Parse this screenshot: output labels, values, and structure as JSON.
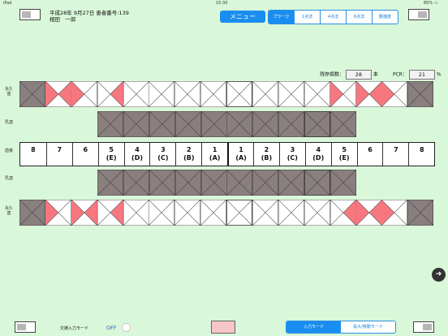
{
  "status_bar": {
    "device": "iPad",
    "time": "15:30",
    "battery": "85% ▭"
  },
  "patient": {
    "line1": "平成28年 9月27日 患者番号:139",
    "line2": "相田　一郎"
  },
  "menu": {
    "label": "メニュー"
  },
  "tabs": [
    {
      "label": "プラーク",
      "active": true
    },
    {
      "label": "1点法",
      "active": false
    },
    {
      "label": "4点法",
      "active": false
    },
    {
      "label": "6点法",
      "active": false
    },
    {
      "label": "動揺度",
      "active": false
    }
  ],
  "counters": {
    "remaining_label": "残存歯数：",
    "remaining_value": "28",
    "remaining_unit": "本",
    "pcr_label": "PCR：",
    "pcr_value": "21",
    "pcr_unit": "%"
  },
  "side_labels": {
    "permanent_upper": "永久歯",
    "deciduous_upper": "乳歯",
    "tooth_number": "歯番",
    "deciduous_lower": "乳歯",
    "permanent_lower": "永久歯"
  },
  "tooth_numbers": [
    {
      "n": "8",
      "sub": ""
    },
    {
      "n": "7",
      "sub": ""
    },
    {
      "n": "6",
      "sub": ""
    },
    {
      "n": "5",
      "sub": "(E)"
    },
    {
      "n": "4",
      "sub": "(D)"
    },
    {
      "n": "3",
      "sub": "(C)"
    },
    {
      "n": "2",
      "sub": "(B)"
    },
    {
      "n": "1",
      "sub": "(A)"
    },
    {
      "n": "1",
      "sub": "(A)"
    },
    {
      "n": "2",
      "sub": "(B)"
    },
    {
      "n": "3",
      "sub": "(C)"
    },
    {
      "n": "4",
      "sub": "(D)"
    },
    {
      "n": "5",
      "sub": "(E)"
    },
    {
      "n": "6",
      "sub": ""
    },
    {
      "n": "7",
      "sub": ""
    },
    {
      "n": "8",
      "sub": ""
    }
  ],
  "upper_permanent": [
    {
      "state": "missing"
    },
    {
      "state": "plaque",
      "m": true,
      "d": true,
      "t": false,
      "b": false
    },
    {
      "state": "plaque",
      "m": true,
      "d": false,
      "t": false,
      "b": false
    },
    {
      "state": "plaque",
      "m": false,
      "d": true,
      "t": false,
      "b": false
    },
    {
      "state": "clear"
    },
    {
      "state": "clear"
    },
    {
      "state": "clear"
    },
    {
      "state": "clear"
    },
    {
      "state": "clear"
    },
    {
      "state": "clear"
    },
    {
      "state": "clear"
    },
    {
      "state": "clear"
    },
    {
      "state": "plaque",
      "m": true,
      "d": false,
      "t": false,
      "b": false
    },
    {
      "state": "plaque",
      "m": true,
      "d": true,
      "t": false,
      "b": false
    },
    {
      "state": "plaque",
      "m": true,
      "d": false,
      "t": false,
      "b": false
    },
    {
      "state": "missing"
    }
  ],
  "lower_permanent": [
    {
      "state": "missing"
    },
    {
      "state": "plaque",
      "m": true,
      "d": false,
      "t": false,
      "b": false
    },
    {
      "state": "plaque",
      "m": true,
      "d": true,
      "t": false,
      "b": false
    },
    {
      "state": "plaque",
      "m": false,
      "d": true,
      "t": false,
      "b": false
    },
    {
      "state": "clear"
    },
    {
      "state": "clear"
    },
    {
      "state": "clear"
    },
    {
      "state": "clear"
    },
    {
      "state": "clear"
    },
    {
      "state": "clear"
    },
    {
      "state": "clear"
    },
    {
      "state": "clear"
    },
    {
      "state": "plaque",
      "m": false,
      "d": true,
      "t": false,
      "b": false
    },
    {
      "state": "plaque",
      "m": true,
      "d": true,
      "t": false,
      "b": false
    },
    {
      "state": "plaque",
      "m": true,
      "d": false,
      "t": false,
      "b": false
    },
    {
      "state": "missing"
    }
  ],
  "deciduous_count": 10,
  "bottom": {
    "toggle_label": "欠損入力モード",
    "toggle_value": "OFF",
    "mode_input": "入力モード",
    "mode_zoom": "拡大/移動モード"
  },
  "colors": {
    "background": "#d9f7d9",
    "accent": "#1a8ef0",
    "plaque": "#f7777f",
    "missing": "#8a7f7f",
    "pink_box": "#f6c6c6"
  },
  "icons": {
    "back": "left-arrow-icon"
  }
}
